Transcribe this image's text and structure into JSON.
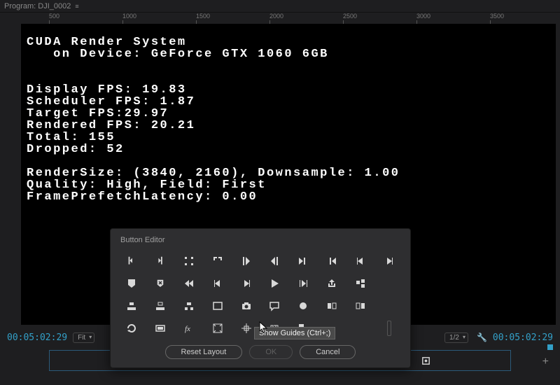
{
  "title_bar": {
    "label": "Program: DJI_0002",
    "menu_glyph": "≡"
  },
  "ruler": {
    "ticks": [
      "500",
      "1000",
      "1500",
      "2000",
      "2500",
      "3000",
      "3500"
    ]
  },
  "debug": {
    "lines": [
      "CUDA Render System",
      "   on Device: GeForce GTX 1060 6GB",
      "",
      "",
      "Display FPS: 19.83",
      "Scheduler FPS: 1.87",
      "Target FPS:29.97",
      "Rendered FPS: 20.21",
      "Total: 155",
      "Dropped: 52",
      "",
      "RenderSize: (3840, 2160), Downsample: 1.00",
      "Quality: High, Field: First",
      "FramePrefetchLatency: 0.00"
    ]
  },
  "status": {
    "tc_left": "00:05:02:29",
    "fit_label": "Fit",
    "res_label": "1/2",
    "tc_right": "00:05:02:29"
  },
  "transport": {
    "icons": [
      "marker",
      "in-bracket",
      "out-bracket",
      "go-in",
      "go-out",
      "step-back",
      "play",
      "step-fwd",
      "go-next",
      "edit1",
      "edit2",
      "edit3",
      "camera",
      "snap"
    ]
  },
  "dialog": {
    "title": "Button Editor",
    "reset": "Reset Layout",
    "ok": "OK",
    "cancel": "Cancel",
    "tooltip": "Show Guides (Ctrl+;)",
    "rows": [
      [
        "in-bracket",
        "out-bracket",
        "mark-clip",
        "mark-sel",
        "go-in",
        "go-out",
        "go-next-edit",
        "go-prev-edit",
        "step-back",
        "step-fwd"
      ],
      [
        "marker",
        "marker-x",
        "rewind",
        "step-back",
        "step-fwd",
        "play",
        "play-in-out",
        "export",
        "share",
        ""
      ],
      [
        "insert",
        "overwrite",
        "lift",
        "frame",
        "camera",
        "comment",
        "record",
        "snap1",
        "snap2",
        ""
      ],
      [
        "loop",
        "proxy",
        "fx",
        "safe-margin",
        "guides",
        "resolution",
        "multi",
        "",
        "",
        "spacer"
      ]
    ]
  },
  "colors": {
    "accent": "#33a0c8",
    "record": "#c82020"
  }
}
